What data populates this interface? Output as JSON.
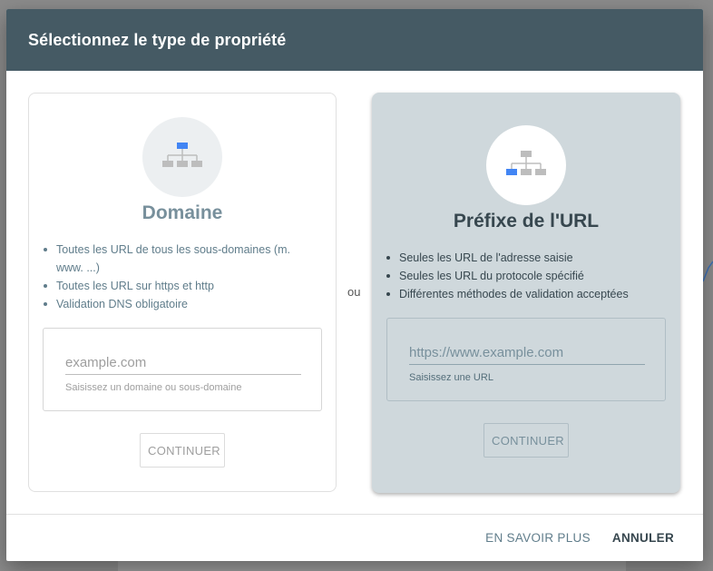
{
  "dialog": {
    "title": "Sélectionnez le type de propriété",
    "or_label": "ou"
  },
  "domain_card": {
    "title": "Domaine",
    "icon": "sitemap-root-icon",
    "bullets": [
      "Toutes les URL de tous les sous-domaines (m. www. ...)",
      "Toutes les URL sur https et http",
      "Validation DNS obligatoire"
    ],
    "input_placeholder": "example.com",
    "input_value": "",
    "hint": "Saisissez un domaine ou sous-domaine",
    "button_label": "CONTINUER"
  },
  "url_card": {
    "title": "Préfixe de l'URL",
    "icon": "sitemap-branch-icon",
    "bullets": [
      "Seules les URL de l'adresse saisie",
      "Seules les URL du protocole spécifié",
      "Différentes méthodes de validation acceptées"
    ],
    "input_placeholder": "https://www.example.com",
    "input_value": "",
    "hint": "Saisissez une URL",
    "button_label": "CONTINUER"
  },
  "footer": {
    "learn_more": "EN SAVOIR PLUS",
    "cancel": "ANNULER"
  },
  "colors": {
    "header": "#455a64",
    "selected_card": "#cfd8dc",
    "icon_blue": "#4285f4",
    "icon_gray": "#bdbdbd"
  }
}
